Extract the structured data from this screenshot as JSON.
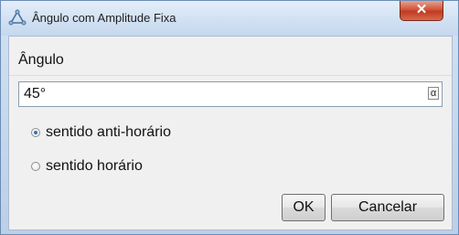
{
  "window": {
    "title": "Ângulo com Amplitude Fixa",
    "close_label": "✕"
  },
  "form": {
    "angle_label": "Ângulo",
    "angle_value": "45°",
    "alpha_icon_label": "α",
    "radio_options": [
      {
        "label": "sentido anti-horário",
        "selected": true
      },
      {
        "label": "sentido horário",
        "selected": false
      }
    ]
  },
  "buttons": {
    "ok_label": "OK",
    "cancel_label": "Cancelar"
  },
  "colors": {
    "titlebar": "#d3e2f3",
    "close_button": "#c03a22",
    "dialog_body": "#f0f0f0",
    "radio_selected": "#3b6fb6"
  }
}
